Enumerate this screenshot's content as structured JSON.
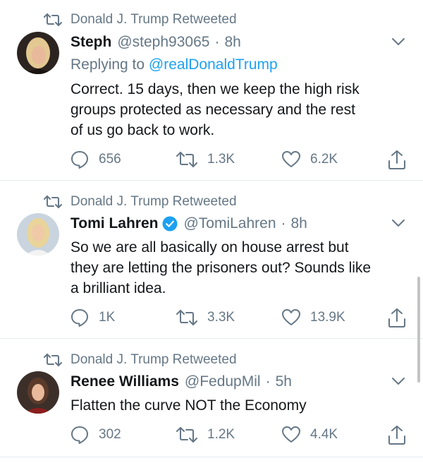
{
  "tweets": [
    {
      "retweeted_by": "Donald J. Trump Retweeted",
      "name": "Steph",
      "handle": "@steph93065",
      "time": "8h",
      "reply_prefix": "Replying to",
      "reply_to": "@realDonaldTrump",
      "lines": [
        "Correct. 15 days, then we keep the high risk",
        "groups protected as necessary and the rest",
        "of us go back to work."
      ],
      "replies": "656",
      "retweets": "1.3K",
      "likes": "6.2K"
    },
    {
      "retweeted_by": "Donald J. Trump Retweeted",
      "name": "Tomi Lahren",
      "verified": true,
      "handle": "@TomiLahren",
      "time": "8h",
      "lines": [
        "So we are all basically on house arrest but",
        "they are letting the prisoners out? Sounds like",
        "a brilliant idea."
      ],
      "replies": "1K",
      "retweets": "3.3K",
      "likes": "13.9K"
    },
    {
      "retweeted_by": "Donald J. Trump Retweeted",
      "name": "Renee Williams",
      "handle": "@FedupMil",
      "time": "5h",
      "lines": [
        "Flatten the curve NOT the Economy"
      ],
      "replies": "302",
      "retweets": "1.2K",
      "likes": "4.4K"
    }
  ],
  "separator": "·",
  "colors": {
    "secondary": "#657786",
    "link": "#1da1f2",
    "text": "#14171a",
    "divider": "#e6ecf0"
  },
  "icons": [
    "retweet-icon",
    "chevron-down-icon",
    "reply-icon",
    "like-icon",
    "share-icon",
    "verified-badge-icon"
  ]
}
